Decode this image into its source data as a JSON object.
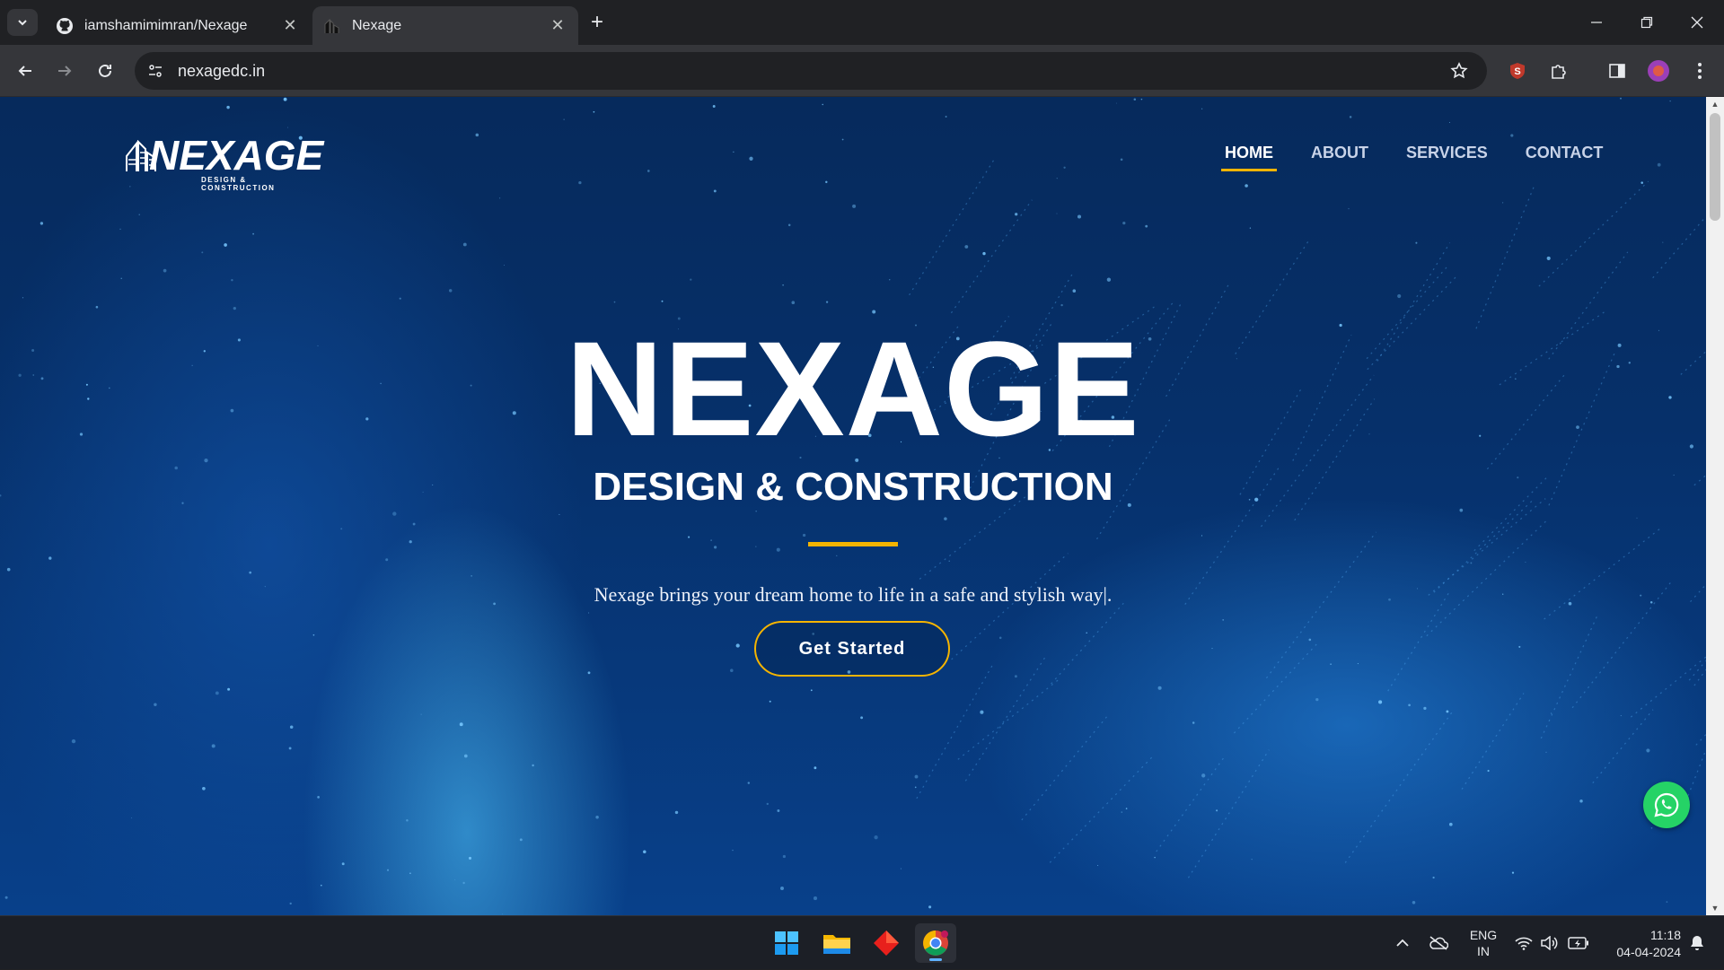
{
  "browser": {
    "tabs": [
      {
        "title": "iamshamimimran/Nexage",
        "icon": "github-icon",
        "active": false
      },
      {
        "title": "Nexage",
        "icon": "site-favicon",
        "active": true
      }
    ],
    "url": "nexagedc.in"
  },
  "site": {
    "logo": {
      "word": "NEXAGE",
      "tagline": "DESIGN & CONSTRUCTION"
    },
    "nav": [
      "HOME",
      "ABOUT",
      "SERVICES",
      "CONTACT"
    ],
    "active_nav": "HOME",
    "hero": {
      "title": "NEXAGE",
      "subtitle": "DESIGN & CONSTRUCTION",
      "tagline": "Nexage brings your dream home to life in a safe and stylish way|.",
      "cta": "Get Started"
    },
    "whatsapp_icon": "whatsapp-icon",
    "colors": {
      "accent": "#f5b400",
      "hero_bg": "#062a5c",
      "whatsapp": "#25d366"
    }
  },
  "taskbar": {
    "apps": [
      "windows-start-icon",
      "file-explorer-icon",
      "red-diamond-app-icon",
      "chrome-icon"
    ],
    "language": {
      "line1": "ENG",
      "line2": "IN"
    },
    "time": "11:18",
    "date": "04-04-2024"
  }
}
